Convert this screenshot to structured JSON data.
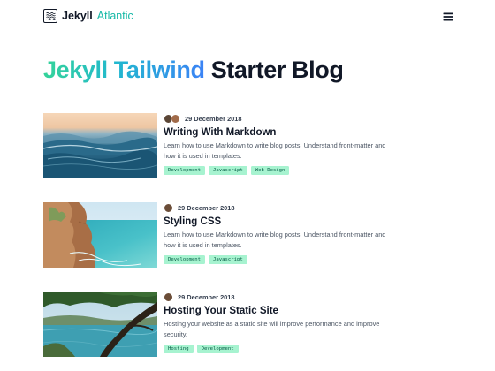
{
  "header": {
    "brand_name": "Jekyll",
    "brand_accent": "Atlantic",
    "logo_icon": "wave-logo-icon",
    "menu_icon": "hamburger-menu-icon"
  },
  "hero": {
    "title_highlight": "Jekyll Tailwind",
    "title_rest": "Starter Blog",
    "gradient_colors": [
      "#34d399",
      "#22b8cf",
      "#3b82f6"
    ]
  },
  "posts": [
    {
      "date": "29 December 2018",
      "title": "Writing With Markdown",
      "excerpt": "Learn how to use Markdown to write blog posts. Understand front-matter and how it is used in templates.",
      "tags": [
        "Development",
        "Javascript",
        "Web Design"
      ]
    },
    {
      "date": "29 December 2018",
      "title": "Styling CSS",
      "excerpt": "Learn how to use Markdown to write blog posts. Understand front-matter and how it is used in templates.",
      "tags": [
        "Development",
        "Javascript"
      ]
    },
    {
      "date": "29 December 2018",
      "title": "Hosting Your Static Site",
      "excerpt": "Hosting your website as a static site will improve performance and improve security.",
      "tags": [
        "Hosting",
        "Development"
      ]
    }
  ]
}
